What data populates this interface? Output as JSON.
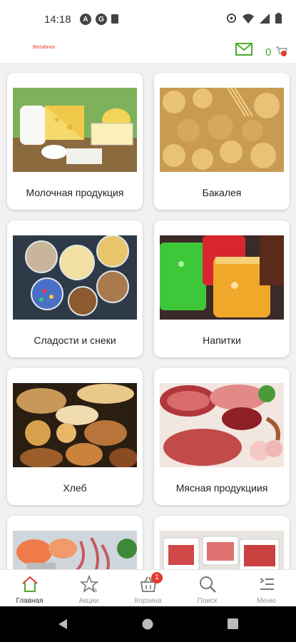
{
  "status_bar": {
    "time": "14:18",
    "icons": [
      "a-badge-icon",
      "b-badge-icon",
      "sd-card-icon",
      "sync-icon",
      "wifi-icon",
      "signal-icon",
      "battery-icon"
    ]
  },
  "app_bar": {
    "logo_text": "Bezabnos",
    "cart_count": "0",
    "icons": [
      "mail-icon",
      "cart-icon"
    ]
  },
  "categories": [
    {
      "label": "Молочная продукция"
    },
    {
      "label": "Бакалея"
    },
    {
      "label": "Сладости и снеки"
    },
    {
      "label": "Напитки"
    },
    {
      "label": "Хлеб"
    },
    {
      "label": "Мясная продукциия"
    },
    {
      "label": ""
    },
    {
      "label": ""
    }
  ],
  "bottom_nav": [
    {
      "label": "Главная",
      "icon": "home-icon",
      "active": true
    },
    {
      "label": "Акции",
      "icon": "star-icon"
    },
    {
      "label": "Корзина",
      "icon": "basket-icon",
      "badge": "1"
    },
    {
      "label": "Поиск",
      "icon": "search-icon"
    },
    {
      "label": "Меню",
      "icon": "menu-icon"
    }
  ],
  "colors": {
    "accent_green": "#4caa2a",
    "accent_red": "#e53a2f"
  }
}
